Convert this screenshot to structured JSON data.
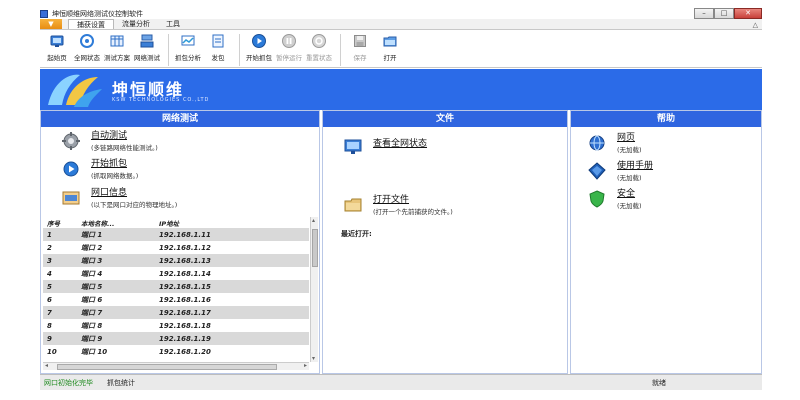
{
  "window": {
    "title": "坤恒顺维网络测试仪控制软件",
    "buttons": [
      "–",
      "□",
      "✕"
    ]
  },
  "menu": {
    "app_button": "▼",
    "tabs": [
      "捕获设置",
      "流量分析",
      "工具"
    ],
    "active_tab": 0,
    "help_caret": "△"
  },
  "ribbon": {
    "groups": [
      [
        {
          "label": "起始页",
          "icon": "home-icon"
        },
        {
          "label": "全网状态",
          "icon": "network-status-icon"
        },
        {
          "label": "测试方案",
          "icon": "test-plan-icon"
        },
        {
          "label": "网络测试",
          "icon": "network-test-icon"
        }
      ],
      [
        {
          "label": "抓包分析",
          "icon": "capture-analysis-icon"
        },
        {
          "label": "发包",
          "icon": "send-packet-icon"
        }
      ],
      [
        {
          "label": "开始抓包",
          "icon": "play-icon"
        },
        {
          "label": "暂停运行",
          "icon": "pause-icon",
          "disabled": true
        },
        {
          "label": "重置状态",
          "icon": "reset-icon",
          "disabled": true
        }
      ],
      [
        {
          "label": "保存",
          "icon": "save-icon",
          "disabled": true
        },
        {
          "label": "打开",
          "icon": "open-folder-icon"
        }
      ]
    ]
  },
  "banner": {
    "brand": "坤恒顺维",
    "subtitle": "KSW TECHNOLOGIES CO.,LTD"
  },
  "panels": {
    "network": {
      "title": "网络测试",
      "entries": [
        {
          "title": "自动测试",
          "sub": "(多链路网络性能测试。)"
        },
        {
          "title": "开始抓包",
          "sub": "(抓取网络数据。)"
        },
        {
          "title": "网口信息",
          "sub": "(以下是网口对应的物理地址。)"
        }
      ],
      "table": {
        "headers": [
          "序号",
          "本地名称...",
          "IP地址"
        ],
        "rows": [
          [
            "1",
            "端口 1",
            "192.168.1.11"
          ],
          [
            "2",
            "端口 2",
            "192.168.1.12"
          ],
          [
            "3",
            "端口 3",
            "192.168.1.13"
          ],
          [
            "4",
            "端口 4",
            "192.168.1.14"
          ],
          [
            "5",
            "端口 5",
            "192.168.1.15"
          ],
          [
            "6",
            "端口 6",
            "192.168.1.16"
          ],
          [
            "7",
            "端口 7",
            "192.168.1.17"
          ],
          [
            "8",
            "端口 8",
            "192.168.1.18"
          ],
          [
            "9",
            "端口 9",
            "192.168.1.19"
          ],
          [
            "10",
            "端口 10",
            "192.168.1.20"
          ]
        ],
        "scroll_up": "▴",
        "scroll_down": "▾",
        "scroll_left": "◂",
        "scroll_right": "▸"
      }
    },
    "file": {
      "title": "文件",
      "entries": [
        {
          "title": "查看全网状态",
          "sub": ""
        },
        {
          "title": "打开文件",
          "sub": "(打开一个先前捕获的文件。)"
        }
      ],
      "recent_label": "最近打开:"
    },
    "help": {
      "title": "帮助",
      "entries": [
        {
          "title": "网页",
          "sub": "(无加载)"
        },
        {
          "title": "使用手册",
          "sub": "(无加载)"
        },
        {
          "title": "安全",
          "sub": "(无加载)"
        }
      ]
    }
  },
  "status": {
    "left": "网口初始化完毕",
    "middle": "抓包统计",
    "right": "就绪"
  },
  "colors": {
    "accent": "#2f65e0",
    "banner": "#2b6be8",
    "status_ok": "#1f8a1f"
  }
}
